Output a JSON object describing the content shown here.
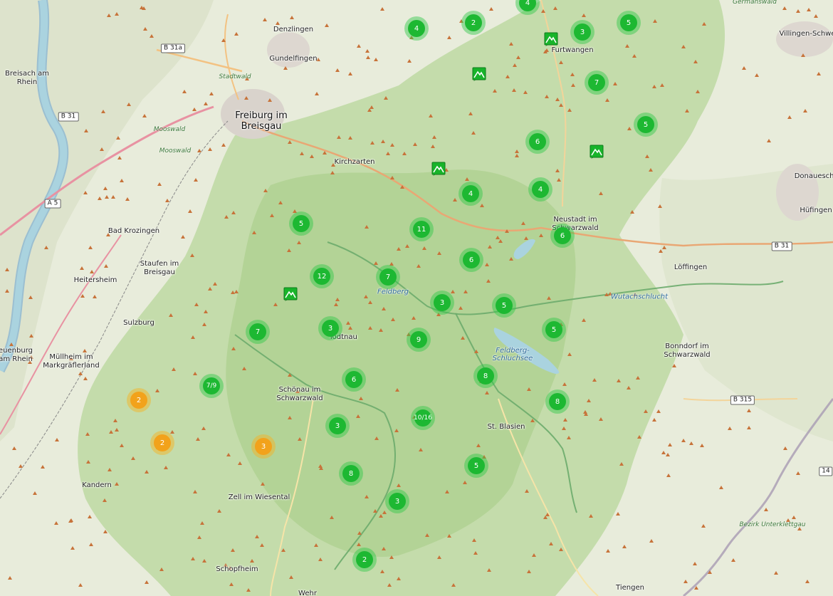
{
  "map": {
    "places": [
      {
        "name": "Denzlingen",
        "big": false
      },
      {
        "name": "Gundelfingen",
        "big": false
      },
      {
        "name": "Breisach am\nRhein",
        "big": false
      },
      {
        "name": "Freiburg im\nBreisgau",
        "big": true
      },
      {
        "name": "Kirchzarten",
        "big": false
      },
      {
        "name": "Furtwangen",
        "big": false
      },
      {
        "name": "Villingen-Schwe",
        "big": false
      },
      {
        "name": "Donaueschi",
        "big": false
      },
      {
        "name": "Hüfingen",
        "big": false
      },
      {
        "name": "Neustadt im\nSchwarzwald",
        "big": false
      },
      {
        "name": "Löffingen",
        "big": false
      },
      {
        "name": "Bad Krozingen",
        "big": false
      },
      {
        "name": "Staufen im\nBreisgau",
        "big": false
      },
      {
        "name": "Heitersheim",
        "big": false
      },
      {
        "name": "Sulzburg",
        "big": false
      },
      {
        "name": "euenburg\nam Rhein",
        "big": false
      },
      {
        "name": "Müllheim im\nMarkgräflerland",
        "big": false
      },
      {
        "name": "Schönau im\nSchwarzwald",
        "big": false
      },
      {
        "name": "Todtnau",
        "big": false
      },
      {
        "name": "St. Blasien",
        "big": false
      },
      {
        "name": "Bonndorf im\nSchwarzwald",
        "big": false
      },
      {
        "name": "Kandern",
        "big": false
      },
      {
        "name": "Zell im Wiesental",
        "big": false
      },
      {
        "name": "Schopfheim",
        "big": false
      },
      {
        "name": "Tiengen",
        "big": false
      },
      {
        "name": "Wehr",
        "big": false
      }
    ],
    "water_labels": [
      "Feldberg-\nSchluchsee",
      "Wutachschlucht",
      "Feldberg"
    ],
    "forest_labels": [
      "Mooswald",
      "Mooswald",
      "Stadtwald",
      "Germanswald",
      "Bezirk Unterklettgau"
    ],
    "road_labels": [
      "B 31a",
      "B 31",
      "A 5",
      "B 31",
      "B 315",
      "14"
    ],
    "clusters": [
      {
        "label": "4",
        "color": "green"
      },
      {
        "label": "2",
        "color": "green"
      },
      {
        "label": "4",
        "color": "green"
      },
      {
        "label": "3",
        "color": "green"
      },
      {
        "label": "5",
        "color": "green"
      },
      {
        "label": "7",
        "color": "green"
      },
      {
        "label": "5",
        "color": "green"
      },
      {
        "label": "6",
        "color": "green"
      },
      {
        "label": "4",
        "color": "green"
      },
      {
        "label": "4",
        "color": "green"
      },
      {
        "label": "11",
        "color": "green"
      },
      {
        "label": "6",
        "color": "green"
      },
      {
        "label": "5",
        "color": "green"
      },
      {
        "label": "6",
        "color": "green"
      },
      {
        "label": "12",
        "color": "green"
      },
      {
        "label": "7",
        "color": "green"
      },
      {
        "label": "3",
        "color": "green"
      },
      {
        "label": "5",
        "color": "green"
      },
      {
        "label": "3",
        "color": "green"
      },
      {
        "label": "5",
        "color": "green"
      },
      {
        "label": "7",
        "color": "green"
      },
      {
        "label": "9",
        "color": "green"
      },
      {
        "label": "7/9",
        "color": "green"
      },
      {
        "label": "6",
        "color": "green"
      },
      {
        "label": "8",
        "color": "green"
      },
      {
        "label": "8",
        "color": "green"
      },
      {
        "label": "10/16",
        "color": "green"
      },
      {
        "label": "3",
        "color": "green"
      },
      {
        "label": "5",
        "color": "green"
      },
      {
        "label": "8",
        "color": "green"
      },
      {
        "label": "3",
        "color": "green"
      },
      {
        "label": "2",
        "color": "green"
      },
      {
        "label": "2",
        "color": "orange"
      },
      {
        "label": "2",
        "color": "orange"
      },
      {
        "label": "3",
        "color": "orange"
      }
    ],
    "hut_markers": [
      "mountain-hut-icon",
      "mountain-hut-icon",
      "mountain-hut-icon",
      "mountain-hut-icon",
      "mountain-hut-icon"
    ],
    "colors": {
      "cluster_green": "#1db832",
      "cluster_orange": "#f2a21b",
      "hut_marker": "#18b42a",
      "forest": "#b9d7a0",
      "water": "#aad3df"
    }
  }
}
